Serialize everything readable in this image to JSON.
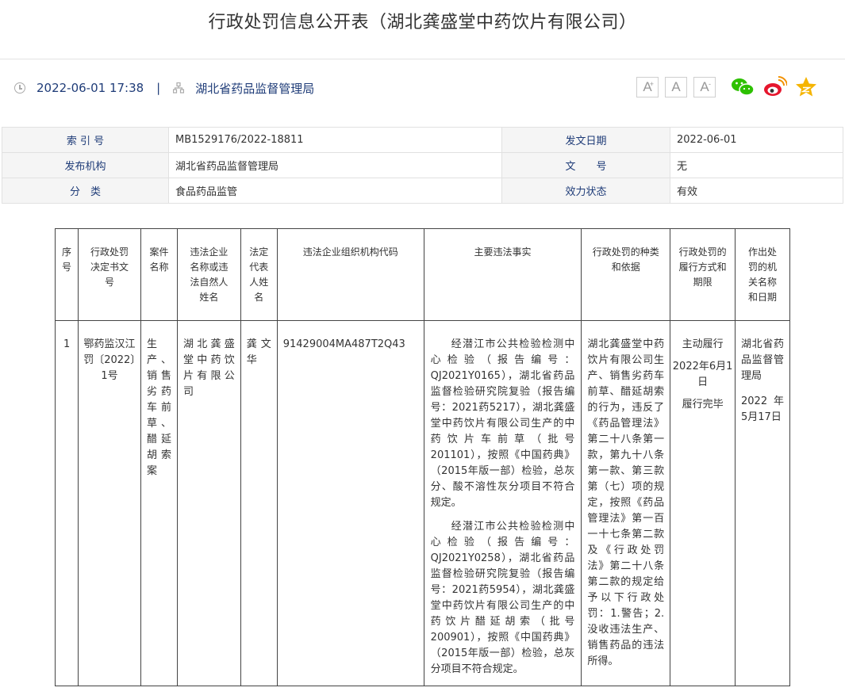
{
  "page_title": "行政处罚信息公开表（湖北龚盛堂中药饮片有限公司）",
  "meta": {
    "datetime": "2022-06-01 17:38",
    "separator": "|",
    "publisher": "湖北省药品监督管理局"
  },
  "font_buttons": [
    {
      "label": "A",
      "sup": "+"
    },
    {
      "label": "A",
      "sup": ""
    },
    {
      "label": "A",
      "sup": "-"
    }
  ],
  "share_icons": [
    "wechat-icon",
    "weibo-icon",
    "favorite-star-icon"
  ],
  "colors": {
    "label_blue": "#1f3c78",
    "wechat": "#2dc100",
    "weibo": "#e6162d",
    "star": "#f5b400"
  },
  "info": {
    "index_label": "索 引 号",
    "index_value": "MB1529176/2022-18811",
    "date_label": "发文日期",
    "date_value": "2022-06-01",
    "org_label": "发布机构",
    "org_value": "湖北省药品监督管理局",
    "docno_label": "文　　号",
    "docno_value": "无",
    "category_label": "分　类",
    "category_value": "食品药品监管",
    "status_label": "效力状态",
    "status_value": "有效"
  },
  "penalty_table": {
    "headers": [
      "序号",
      "行政处罚决定书文号",
      "案件名称",
      "违法企业名称或违法自然人姓名",
      "法定代表人姓名",
      "违法企业组织机构代码",
      "主要违法事实",
      "行政处罚的种类和依据",
      "行政处罚的履行方式和期限",
      "作出处罚的机关名称和日期"
    ],
    "row": {
      "no": "1",
      "doc_no": "鄂药监汉江罚〔2022〕1号",
      "case_name": "生产、销售劣药车前草、醋延胡索案",
      "company": "湖北龚盛堂中药饮片有限公司",
      "legal_rep": "龚文华",
      "org_code": "91429004MA487T2Q43",
      "facts_1": "经潜江市公共检验检测中心检验（报告编号：QJ2021Y0165），湖北省药品监督检验研究院复验（报告编号：2021药5217），湖北龚盛堂中药饮片有限公司生产的中药饮片车前草（批号201101），按照《中国药典》（2015年版一部）检验，总灰分、酸不溶性灰分项目不符合规定。",
      "facts_2": "经潜江市公共检验检测中心检验（报告编号：QJ2021Y0258），湖北省药品监督检验研究院复验（报告编号：2021药5954），湖北龚盛堂中药饮片有限公司生产的中药饮片醋延胡索（批号200901），按照《中国药典》（2015年版一部）检验，总灰分项目不符合规定。",
      "penalty_basis": "湖北龚盛堂中药饮片有限公司生产、销售劣药车前草、醋延胡索的行为，违反了《药品管理法》第二十八条第一款，第九十八条第一款、第三款第（七）项的规定，按照《药品管理法》第一百一十七条第二款及《行政处罚法》第二十八条第二款的规定给予以下行政处罚：1.警告；2.没收违法生产、销售药品的违法所得。",
      "fulfil_mode": "主动履行",
      "fulfil_date": "2022年6月1日",
      "fulfil_status": "履行完毕",
      "authority": "湖北省药品监督管理局",
      "decision_date": "2022年5月17日"
    }
  }
}
